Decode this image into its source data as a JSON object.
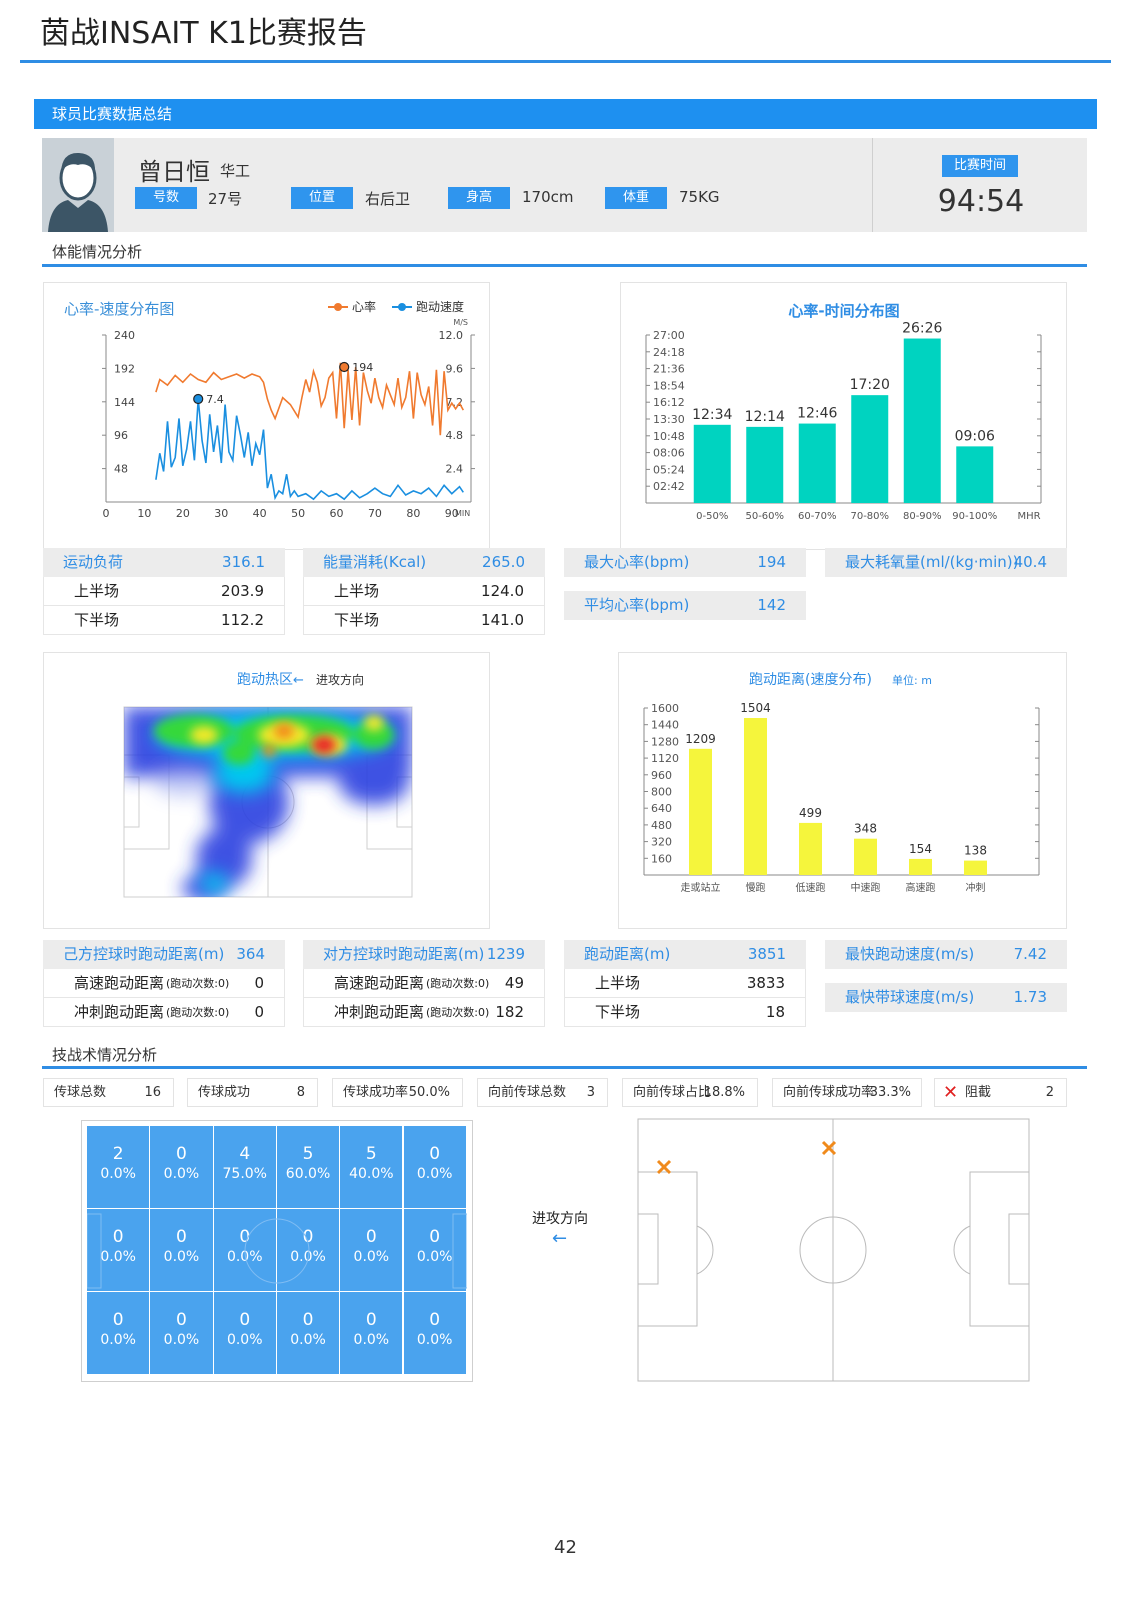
{
  "title": "茵战INSAIT K1比赛报告",
  "section_summary": "球员比赛数据总结",
  "player": {
    "name": "曾日恒",
    "team": "华工",
    "fields": [
      {
        "label": "号数",
        "value": "27号"
      },
      {
        "label": "位置",
        "value": "右后卫"
      },
      {
        "label": "身高",
        "value": "170cm"
      },
      {
        "label": "体重",
        "value": "75KG"
      }
    ],
    "match_time_label": "比赛时间",
    "match_time": "94:54"
  },
  "physical_title": "体能情况分析",
  "tactical_title": "技战术情况分析",
  "chart_data": [
    {
      "type": "line",
      "title": "心率-速度分布图",
      "legend": [
        "心率",
        "跑动速度"
      ],
      "y_left_ticks": [
        "240",
        "192",
        "144",
        "96",
        "48"
      ],
      "y_right_ticks": [
        "12.0",
        "9.6",
        "7.2",
        "4.8",
        "2.4"
      ],
      "y_right_unit": "M/S",
      "x_ticks": [
        "0",
        "10",
        "20",
        "30",
        "40",
        "50",
        "60",
        "70",
        "80",
        "90"
      ],
      "x_unit": "MIN",
      "ylim_left": [
        0,
        240
      ],
      "ylim_right": [
        0,
        12
      ],
      "xlim": [
        0,
        95
      ],
      "series": [
        {
          "name": "心率",
          "color": "#f07a2f",
          "axis": "left",
          "x": [
            13,
            14,
            16,
            18,
            20,
            22,
            24,
            26,
            28,
            30,
            32,
            34,
            36,
            38,
            40,
            41,
            42,
            43,
            44,
            46,
            48,
            50,
            51,
            52,
            53,
            54,
            55,
            56,
            57,
            58,
            59,
            60,
            61,
            62,
            63,
            64,
            65,
            66,
            67,
            68,
            69,
            70,
            71,
            72,
            73,
            74,
            75,
            76,
            77,
            78,
            79,
            80,
            81,
            82,
            83,
            84,
            85,
            86,
            87,
            88,
            89,
            90,
            91,
            92,
            93
          ],
          "y": [
            158,
            176,
            168,
            182,
            172,
            184,
            176,
            172,
            186,
            176,
            180,
            184,
            178,
            184,
            180,
            172,
            148,
            132,
            120,
            150,
            140,
            122,
            150,
            176,
            158,
            188,
            172,
            138,
            150,
            178,
            186,
            120,
            200,
            106,
            190,
            118,
            194,
            110,
            186,
            160,
            142,
            178,
            150,
            136,
            168,
            154,
            140,
            178,
            136,
            150,
            188,
            120,
            186,
            154,
            140,
            166,
            110,
            190,
            96,
            188,
            132,
            142,
            134,
            142,
            132
          ]
        },
        {
          "name": "跑动速度",
          "color": "#1a8fe0",
          "axis": "right",
          "x": [
            13,
            14,
            15,
            16,
            17,
            18,
            19,
            20,
            21,
            22,
            23,
            24,
            25,
            26,
            27,
            28,
            29,
            30,
            31,
            32,
            33,
            34,
            35,
            36,
            37,
            38,
            39,
            40,
            41,
            42,
            43,
            44,
            45,
            46,
            47,
            48,
            49,
            50,
            52,
            54,
            56,
            58,
            60,
            62,
            64,
            66,
            68,
            70,
            72,
            74,
            76,
            78,
            80,
            82,
            84,
            86,
            88,
            90,
            92,
            93
          ],
          "y": [
            1.6,
            3.5,
            2.2,
            5.8,
            2.5,
            3.2,
            6.0,
            2.6,
            3.8,
            5.8,
            3.0,
            7.4,
            4.4,
            2.8,
            6.3,
            3.6,
            5.5,
            2.8,
            7.0,
            3.6,
            3.0,
            6.2,
            4.8,
            3.2,
            5.0,
            2.6,
            4.2,
            3.4,
            5.2,
            1.0,
            2.0,
            0.3,
            0.8,
            0.6,
            2.0,
            0.4,
            0.8,
            0.4,
            0.6,
            0.2,
            0.8,
            0.4,
            0.6,
            0.2,
            0.8,
            0.3,
            0.6,
            1.0,
            0.6,
            0.4,
            1.2,
            0.5,
            0.8,
            0.6,
            1.0,
            0.4,
            1.2,
            0.6,
            1.1,
            0.7
          ]
        }
      ],
      "annotations": [
        {
          "x": 62,
          "y": 194,
          "label": "194",
          "series": "心率"
        },
        {
          "x": 24,
          "y": 7.4,
          "label": "7.4",
          "series": "跑动速度"
        }
      ]
    },
    {
      "type": "bar",
      "title": "心率-时间分布图",
      "categories": [
        "0-50%",
        "50-60%",
        "60-70%",
        "70-80%",
        "80-90%",
        "90-100%"
      ],
      "x_unit": "MHR",
      "values": [
        754,
        734,
        766,
        1040,
        1586,
        546
      ],
      "labels": [
        "12:34",
        "12:14",
        "12:46",
        "17:20",
        "26:26",
        "09:06"
      ],
      "y_ticks": [
        "27:00",
        "24:18",
        "21:36",
        "18:54",
        "16:12",
        "13:30",
        "10:48",
        "08:06",
        "05:24",
        "02:42"
      ],
      "ylim": [
        0,
        1620
      ],
      "color": "#00d3c0"
    },
    {
      "type": "bar",
      "title": "跑动距离(速度分布)",
      "unit_label": "单位: m",
      "categories": [
        "走或站立",
        "慢跑",
        "低速跑",
        "中速跑",
        "高速跑",
        "冲刺"
      ],
      "values": [
        1209,
        1504,
        499,
        348,
        154,
        138
      ],
      "y_ticks": [
        "1600",
        "1440",
        "1280",
        "1120",
        "960",
        "800",
        "640",
        "480",
        "320",
        "160"
      ],
      "ylim": [
        0,
        1600
      ],
      "color": "#f5f53c"
    }
  ],
  "heatmap": {
    "title": "跑动热区",
    "direction": "进攻方向"
  },
  "stats_top": [
    {
      "head": [
        "运动负荷",
        "316.1"
      ],
      "rows": [
        [
          "上半场",
          "203.9"
        ],
        [
          "下半场",
          "112.2"
        ]
      ]
    },
    {
      "head": [
        "能量消耗(Kcal)",
        "265.0"
      ],
      "rows": [
        [
          "上半场",
          "124.0"
        ],
        [
          "下半场",
          "141.0"
        ]
      ]
    },
    {
      "head": [
        "最大心率(bpm)",
        "194"
      ],
      "rows": []
    },
    {
      "head": [
        "最大耗氧量(ml/(kg·min))",
        "40.4"
      ],
      "rows": []
    }
  ],
  "stat_avg_hr": [
    "平均心率(bpm)",
    "142"
  ],
  "stats_mid": [
    {
      "head": [
        "己方控球时跑动距离(m)",
        "364"
      ],
      "rows": [
        [
          "高速跑动距离",
          "(跑动次数:0)",
          "0"
        ],
        [
          "冲刺跑动距离",
          "(跑动次数:0)",
          "0"
        ]
      ]
    },
    {
      "head": [
        "对方控球时跑动距离(m)",
        "1239"
      ],
      "rows": [
        [
          "高速跑动距离",
          "(跑动次数:0)",
          "49"
        ],
        [
          "冲刺跑动距离",
          "(跑动次数:0)",
          "182"
        ]
      ]
    },
    {
      "head": [
        "跑动距离(m)",
        "3851"
      ],
      "rows": [
        [
          "上半场",
          "",
          "3833"
        ],
        [
          "下半场",
          "",
          "18"
        ]
      ]
    },
    {
      "head": [
        "最快跑动速度(m/s)",
        "7.42"
      ],
      "rows": []
    }
  ],
  "stat_dribble": [
    "最快带球速度(m/s)",
    "1.73"
  ],
  "pass_stats": [
    {
      "label": "传球总数",
      "value": "16"
    },
    {
      "label": "传球成功",
      "value": "8"
    },
    {
      "label": "传球成功率",
      "value": "50.0%"
    },
    {
      "label": "向前传球总数",
      "value": "3"
    },
    {
      "label": "向前传球占比",
      "value": "18.8%"
    },
    {
      "label": "向前传球成功率",
      "value": "33.3%"
    },
    {
      "label": "阻截",
      "value": "2"
    }
  ],
  "pass_grid": [
    [
      [
        "2",
        "0.0%"
      ],
      [
        "0",
        "0.0%"
      ],
      [
        "4",
        "75.0%"
      ],
      [
        "5",
        "60.0%"
      ],
      [
        "5",
        "40.0%"
      ],
      [
        "0",
        "0.0%"
      ]
    ],
    [
      [
        "0",
        "0.0%"
      ],
      [
        "0",
        "0.0%"
      ],
      [
        "0",
        "0.0%"
      ],
      [
        "0",
        "0.0%"
      ],
      [
        "0",
        "0.0%"
      ],
      [
        "0",
        "0.0%"
      ]
    ],
    [
      [
        "0",
        "0.0%"
      ],
      [
        "0",
        "0.0%"
      ],
      [
        "0",
        "0.0%"
      ],
      [
        "0",
        "0.0%"
      ],
      [
        "0",
        "0.0%"
      ],
      [
        "0",
        "0.0%"
      ]
    ]
  ],
  "attack_direction": "进攻方向",
  "arrow": "←",
  "page_number": "42",
  "colors": {
    "accent": "#2f8de4",
    "heart": "#f07a2f",
    "speed": "#1a8fe0",
    "teal": "#00d3c0",
    "yellow": "#f5f53c",
    "cross": "#f08a1c"
  }
}
